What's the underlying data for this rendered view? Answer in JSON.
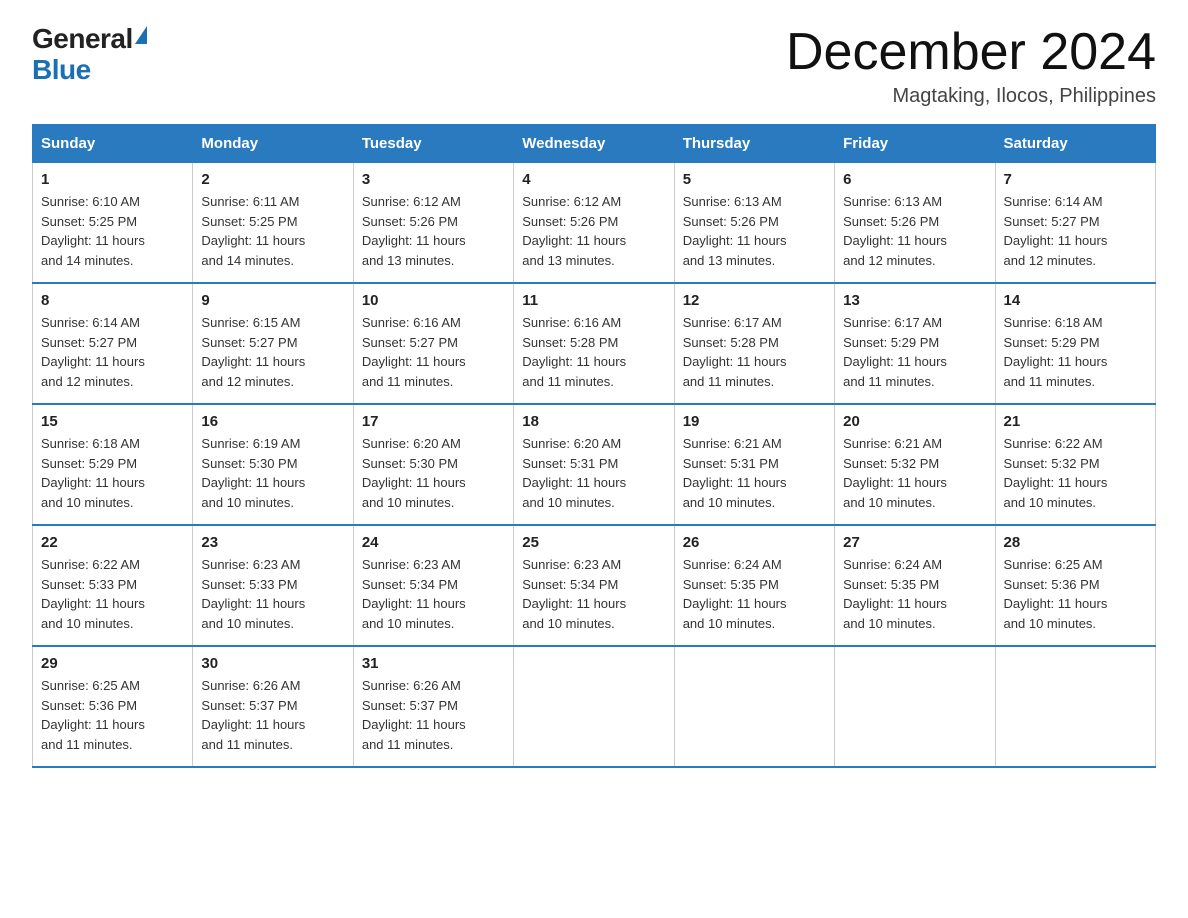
{
  "header": {
    "logo_general": "General",
    "logo_blue": "Blue",
    "month_title": "December 2024",
    "location": "Magtaking, Ilocos, Philippines"
  },
  "days_of_week": [
    "Sunday",
    "Monday",
    "Tuesday",
    "Wednesday",
    "Thursday",
    "Friday",
    "Saturday"
  ],
  "weeks": [
    [
      {
        "day": "1",
        "sunrise": "6:10 AM",
        "sunset": "5:25 PM",
        "daylight": "11 hours and 14 minutes."
      },
      {
        "day": "2",
        "sunrise": "6:11 AM",
        "sunset": "5:25 PM",
        "daylight": "11 hours and 14 minutes."
      },
      {
        "day": "3",
        "sunrise": "6:12 AM",
        "sunset": "5:26 PM",
        "daylight": "11 hours and 13 minutes."
      },
      {
        "day": "4",
        "sunrise": "6:12 AM",
        "sunset": "5:26 PM",
        "daylight": "11 hours and 13 minutes."
      },
      {
        "day": "5",
        "sunrise": "6:13 AM",
        "sunset": "5:26 PM",
        "daylight": "11 hours and 13 minutes."
      },
      {
        "day": "6",
        "sunrise": "6:13 AM",
        "sunset": "5:26 PM",
        "daylight": "11 hours and 12 minutes."
      },
      {
        "day": "7",
        "sunrise": "6:14 AM",
        "sunset": "5:27 PM",
        "daylight": "11 hours and 12 minutes."
      }
    ],
    [
      {
        "day": "8",
        "sunrise": "6:14 AM",
        "sunset": "5:27 PM",
        "daylight": "11 hours and 12 minutes."
      },
      {
        "day": "9",
        "sunrise": "6:15 AM",
        "sunset": "5:27 PM",
        "daylight": "11 hours and 12 minutes."
      },
      {
        "day": "10",
        "sunrise": "6:16 AM",
        "sunset": "5:27 PM",
        "daylight": "11 hours and 11 minutes."
      },
      {
        "day": "11",
        "sunrise": "6:16 AM",
        "sunset": "5:28 PM",
        "daylight": "11 hours and 11 minutes."
      },
      {
        "day": "12",
        "sunrise": "6:17 AM",
        "sunset": "5:28 PM",
        "daylight": "11 hours and 11 minutes."
      },
      {
        "day": "13",
        "sunrise": "6:17 AM",
        "sunset": "5:29 PM",
        "daylight": "11 hours and 11 minutes."
      },
      {
        "day": "14",
        "sunrise": "6:18 AM",
        "sunset": "5:29 PM",
        "daylight": "11 hours and 11 minutes."
      }
    ],
    [
      {
        "day": "15",
        "sunrise": "6:18 AM",
        "sunset": "5:29 PM",
        "daylight": "11 hours and 10 minutes."
      },
      {
        "day": "16",
        "sunrise": "6:19 AM",
        "sunset": "5:30 PM",
        "daylight": "11 hours and 10 minutes."
      },
      {
        "day": "17",
        "sunrise": "6:20 AM",
        "sunset": "5:30 PM",
        "daylight": "11 hours and 10 minutes."
      },
      {
        "day": "18",
        "sunrise": "6:20 AM",
        "sunset": "5:31 PM",
        "daylight": "11 hours and 10 minutes."
      },
      {
        "day": "19",
        "sunrise": "6:21 AM",
        "sunset": "5:31 PM",
        "daylight": "11 hours and 10 minutes."
      },
      {
        "day": "20",
        "sunrise": "6:21 AM",
        "sunset": "5:32 PM",
        "daylight": "11 hours and 10 minutes."
      },
      {
        "day": "21",
        "sunrise": "6:22 AM",
        "sunset": "5:32 PM",
        "daylight": "11 hours and 10 minutes."
      }
    ],
    [
      {
        "day": "22",
        "sunrise": "6:22 AM",
        "sunset": "5:33 PM",
        "daylight": "11 hours and 10 minutes."
      },
      {
        "day": "23",
        "sunrise": "6:23 AM",
        "sunset": "5:33 PM",
        "daylight": "11 hours and 10 minutes."
      },
      {
        "day": "24",
        "sunrise": "6:23 AM",
        "sunset": "5:34 PM",
        "daylight": "11 hours and 10 minutes."
      },
      {
        "day": "25",
        "sunrise": "6:23 AM",
        "sunset": "5:34 PM",
        "daylight": "11 hours and 10 minutes."
      },
      {
        "day": "26",
        "sunrise": "6:24 AM",
        "sunset": "5:35 PM",
        "daylight": "11 hours and 10 minutes."
      },
      {
        "day": "27",
        "sunrise": "6:24 AM",
        "sunset": "5:35 PM",
        "daylight": "11 hours and 10 minutes."
      },
      {
        "day": "28",
        "sunrise": "6:25 AM",
        "sunset": "5:36 PM",
        "daylight": "11 hours and 10 minutes."
      }
    ],
    [
      {
        "day": "29",
        "sunrise": "6:25 AM",
        "sunset": "5:36 PM",
        "daylight": "11 hours and 11 minutes."
      },
      {
        "day": "30",
        "sunrise": "6:26 AM",
        "sunset": "5:37 PM",
        "daylight": "11 hours and 11 minutes."
      },
      {
        "day": "31",
        "sunrise": "6:26 AM",
        "sunset": "5:37 PM",
        "daylight": "11 hours and 11 minutes."
      },
      null,
      null,
      null,
      null
    ]
  ],
  "labels": {
    "sunrise": "Sunrise:",
    "sunset": "Sunset:",
    "daylight": "Daylight:"
  }
}
